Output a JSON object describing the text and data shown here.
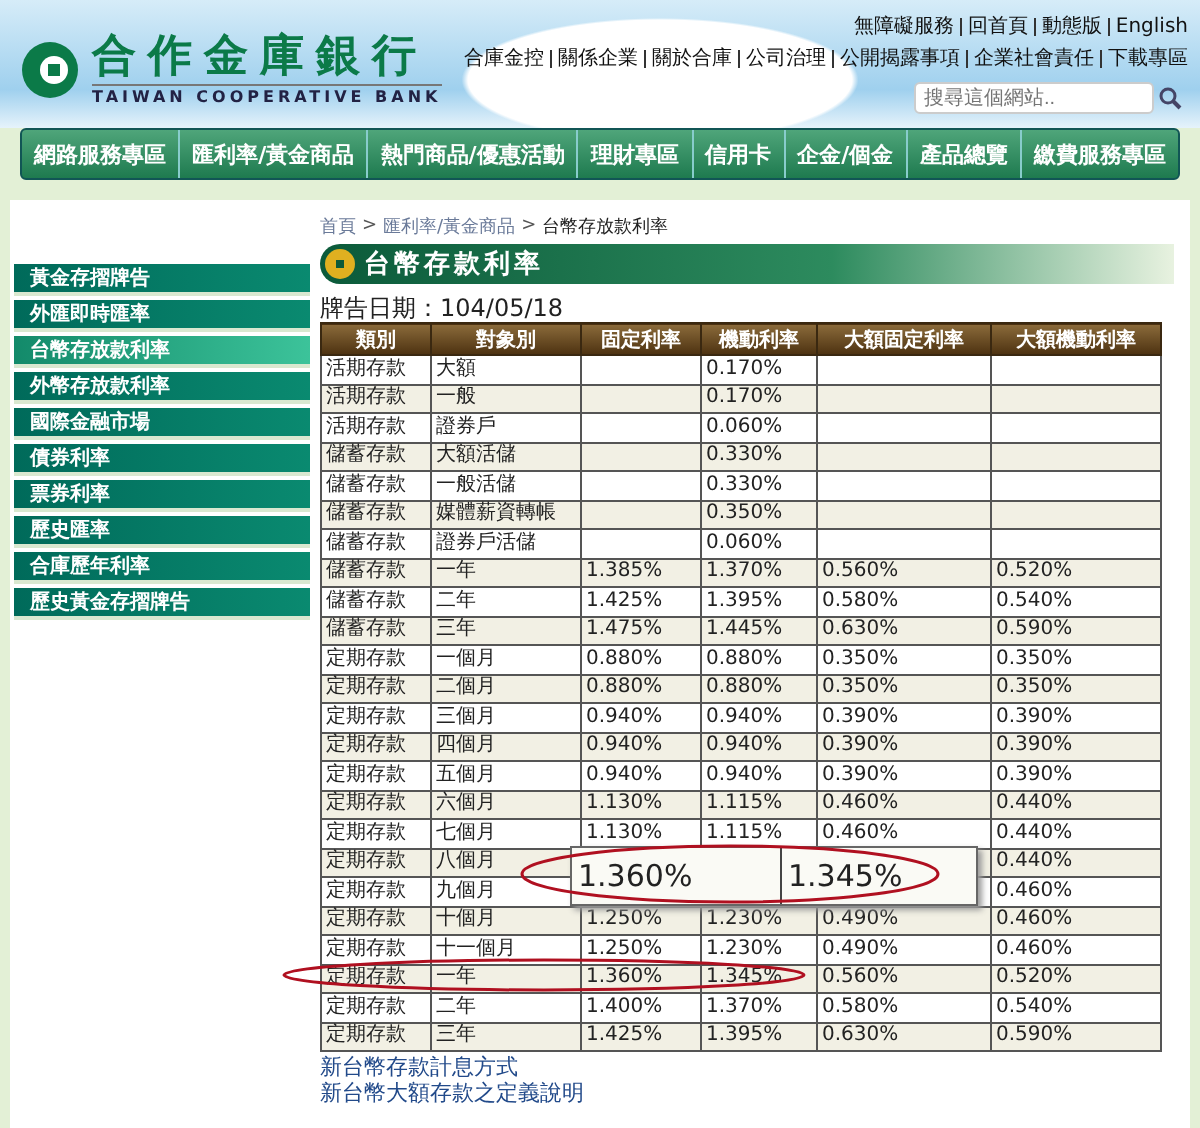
{
  "header": {
    "logo_name": "合作金庫銀行",
    "logo_english": "TAIWAN COOPERATIVE BANK",
    "top_links": [
      "無障礙服務",
      "回首頁",
      "動態版",
      "English"
    ],
    "sub_links": [
      "合庫金控",
      "關係企業",
      "關於合庫",
      "公司治理",
      "公開揭露事項",
      "企業社會責任",
      "下載專區"
    ],
    "search": {
      "placeholder": "搜尋這個網站.."
    }
  },
  "nav": [
    "網路服務專區",
    "匯利率/黃金商品",
    "熱門商品/優惠活動",
    "理財專區",
    "信用卡",
    "企金/個金",
    "產品總覽",
    "繳費服務專區"
  ],
  "sidebar": {
    "items": [
      {
        "label": "黃金存摺牌告",
        "selected": false
      },
      {
        "label": "外匯即時匯率",
        "selected": false
      },
      {
        "label": "台幣存放款利率",
        "selected": true
      },
      {
        "label": "外幣存放款利率",
        "selected": false
      },
      {
        "label": "國際金融市場",
        "selected": false
      },
      {
        "label": "債券利率",
        "selected": false
      },
      {
        "label": "票券利率",
        "selected": false
      },
      {
        "label": "歷史匯率",
        "selected": false
      },
      {
        "label": "合庫歷年利率",
        "selected": false
      },
      {
        "label": "歷史黃金存摺牌告",
        "selected": false
      }
    ]
  },
  "breadcrumb": {
    "items": [
      "首頁",
      "匯利率/黃金商品",
      "台幣存放款利率"
    ],
    "separator": ">"
  },
  "page_title": "台幣存款利率",
  "date_label": "牌告日期：104/05/18",
  "table": {
    "columns": [
      "類別",
      "對象別",
      "固定利率",
      "機動利率",
      "大額固定利率",
      "大額機動利率"
    ],
    "rows": [
      [
        "活期存款",
        "大額",
        null,
        "0.170%",
        null,
        null
      ],
      [
        "活期存款",
        "一般",
        null,
        "0.170%",
        null,
        null
      ],
      [
        "活期存款",
        "證券戶",
        null,
        "0.060%",
        null,
        null
      ],
      [
        "儲蓄存款",
        "大額活儲",
        null,
        "0.330%",
        null,
        null
      ],
      [
        "儲蓄存款",
        "一般活儲",
        null,
        "0.330%",
        null,
        null
      ],
      [
        "儲蓄存款",
        "媒體薪資轉帳",
        null,
        "0.350%",
        null,
        null
      ],
      [
        "儲蓄存款",
        "證券戶活儲",
        null,
        "0.060%",
        null,
        null
      ],
      [
        "儲蓄存款",
        "一年",
        "1.385%",
        "1.370%",
        "0.560%",
        "0.520%"
      ],
      [
        "儲蓄存款",
        "二年",
        "1.425%",
        "1.395%",
        "0.580%",
        "0.540%"
      ],
      [
        "儲蓄存款",
        "三年",
        "1.475%",
        "1.445%",
        "0.630%",
        "0.590%"
      ],
      [
        "定期存款",
        "一個月",
        "0.880%",
        "0.880%",
        "0.350%",
        "0.350%"
      ],
      [
        "定期存款",
        "二個月",
        "0.880%",
        "0.880%",
        "0.350%",
        "0.350%"
      ],
      [
        "定期存款",
        "三個月",
        "0.940%",
        "0.940%",
        "0.390%",
        "0.390%"
      ],
      [
        "定期存款",
        "四個月",
        "0.940%",
        "0.940%",
        "0.390%",
        "0.390%"
      ],
      [
        "定期存款",
        "五個月",
        "0.940%",
        "0.940%",
        "0.390%",
        "0.390%"
      ],
      [
        "定期存款",
        "六個月",
        "1.130%",
        "1.115%",
        "0.460%",
        "0.440%"
      ],
      [
        "定期存款",
        "七個月",
        "1.130%",
        "1.115%",
        "0.460%",
        "0.440%"
      ],
      [
        "定期存款",
        "八個月",
        null,
        null,
        null,
        "0.440%"
      ],
      [
        "定期存款",
        "九個月",
        null,
        null,
        null,
        "0.460%"
      ],
      [
        "定期存款",
        "十個月",
        "1.250%",
        "1.230%",
        "0.490%",
        "0.460%"
      ],
      [
        "定期存款",
        "十一個月",
        "1.250%",
        "1.230%",
        "0.490%",
        "0.460%"
      ],
      [
        "定期存款",
        "一年",
        "1.360%",
        "1.345%",
        "0.560%",
        "0.520%"
      ],
      [
        "定期存款",
        "二年",
        "1.400%",
        "1.370%",
        "0.580%",
        "0.540%"
      ],
      [
        "定期存款",
        "三年",
        "1.425%",
        "1.395%",
        "0.630%",
        "0.590%"
      ]
    ]
  },
  "callout": {
    "values": [
      "1.360%",
      "1.345%"
    ]
  },
  "footer_links": [
    "新台幣存款計息方式",
    "新台幣大額存款之定義說明"
  ]
}
